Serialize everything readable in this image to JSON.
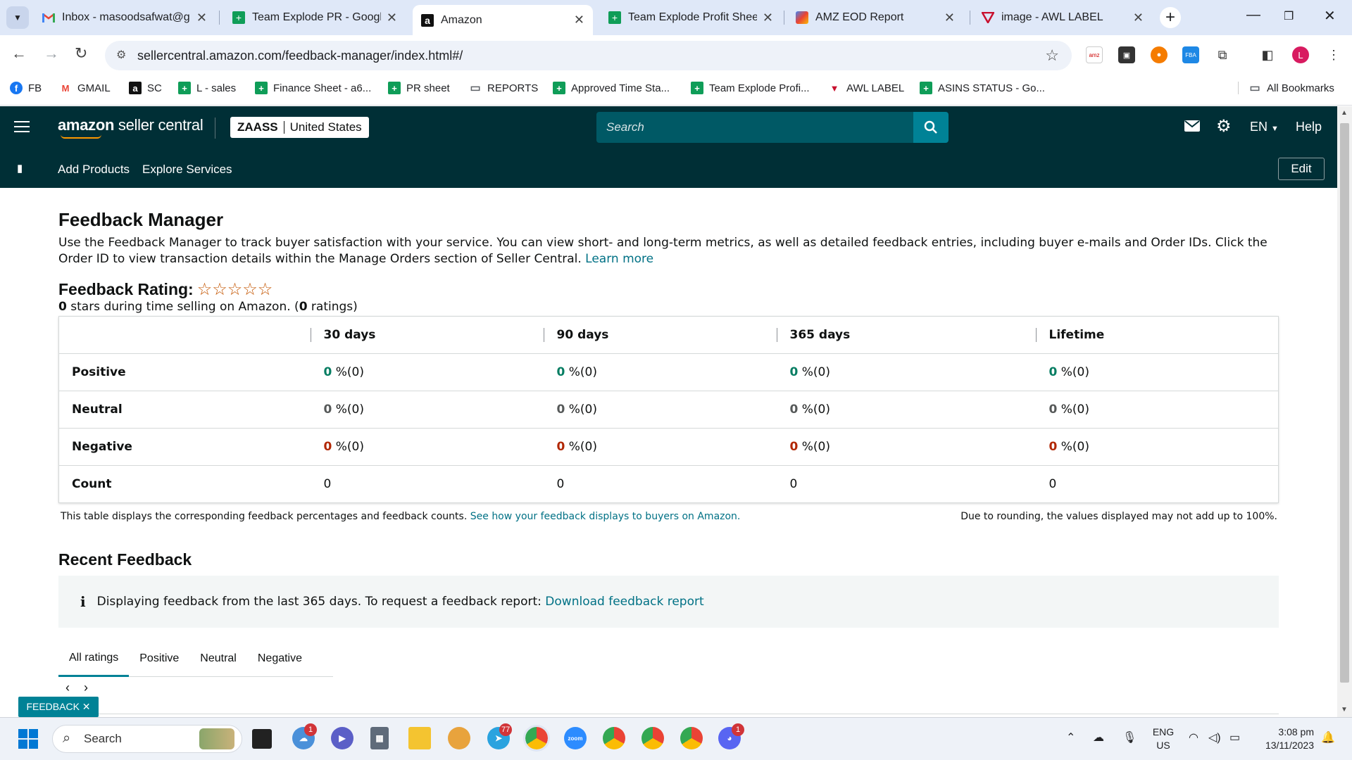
{
  "browser": {
    "tabs": [
      {
        "title": "Inbox - masoodsafwat@g",
        "icon": "gmail-icon"
      },
      {
        "title": "Team Explode PR - Googl",
        "icon": "sheets-icon"
      },
      {
        "title": "Amazon",
        "icon": "amazon-icon"
      },
      {
        "title": "Team Explode Profit Sheet",
        "icon": "sheets-icon"
      },
      {
        "title": "AMZ EOD Report",
        "icon": "report-icon"
      },
      {
        "title": "image - AWL LABEL",
        "icon": "awl-icon"
      }
    ],
    "url_host": "sellercentral.amazon.com",
    "url_path": "/feedback-manager/index.html#/",
    "profile_initial": "L",
    "bookmarks": [
      {
        "label": "FB"
      },
      {
        "label": "GMAIL"
      },
      {
        "label": "SC"
      },
      {
        "label": "L - sales"
      },
      {
        "label": "Finance Sheet - a6..."
      },
      {
        "label": "PR sheet"
      },
      {
        "label": "REPORTS"
      },
      {
        "label": "Approved Time Sta..."
      },
      {
        "label": "Team Explode Profi..."
      },
      {
        "label": "AWL LABEL"
      },
      {
        "label": "ASINS STATUS - Go..."
      }
    ],
    "all_bookmarks": "All Bookmarks"
  },
  "header": {
    "logo_brand": "amazon",
    "logo_rest": " seller central",
    "store": "ZAASS",
    "marketplace": "United States",
    "search_placeholder": "Search",
    "language": "EN",
    "help": "Help",
    "nav": [
      "Add Products",
      "Explore Services"
    ],
    "edit": "Edit"
  },
  "page": {
    "title": "Feedback Manager",
    "intro": "Use the Feedback Manager to track buyer satisfaction with your service. You can view short- and long-term metrics, as well as detailed feedback entries, including buyer e-mails and Order IDs. Click the Order ID to view transaction details within the Manage Orders section of Seller Central.",
    "learn_more": "Learn more",
    "rating_label": "Feedback Rating:",
    "stars": "☆☆☆☆☆",
    "stars_value": "0",
    "stars_text": " stars during time selling on Amazon. (",
    "ratings_count": "0",
    "ratings_suffix": " ratings)",
    "table": {
      "columns": [
        "30 days",
        "90 days",
        "365 days",
        "Lifetime"
      ],
      "rows": [
        {
          "label": "Positive",
          "values": [
            "0",
            "0",
            "0",
            "0"
          ],
          "suffix": " %(0)"
        },
        {
          "label": "Neutral",
          "values": [
            "0",
            "0",
            "0",
            "0"
          ],
          "suffix": " %(0)"
        },
        {
          "label": "Negative",
          "values": [
            "0",
            "0",
            "0",
            "0"
          ],
          "suffix": " %(0)"
        },
        {
          "label": "Count",
          "values": [
            "0",
            "0",
            "0",
            "0"
          ]
        }
      ]
    },
    "table_note": "This table displays the corresponding feedback percentages and feedback counts.",
    "table_note_link": "See how your feedback displays to buyers on Amazon.",
    "rounding_note": "Due to rounding, the values displayed may not add up to 100%.",
    "recent_title": "Recent Feedback",
    "alert_text": "Displaying feedback from the last 365 days. To request a feedback report:",
    "alert_link": "Download feedback report",
    "filter_tabs": [
      "All ratings",
      "Positive",
      "Neutral",
      "Negative"
    ],
    "feedback_tag": "FEEDBACK ✕"
  },
  "taskbar": {
    "search": "Search",
    "badges": {
      "weather": "1",
      "telegram": "77",
      "discord": "1"
    },
    "lang_line1": "ENG",
    "lang_line2": "US",
    "time": "3:08 pm",
    "date": "13/11/2023"
  }
}
